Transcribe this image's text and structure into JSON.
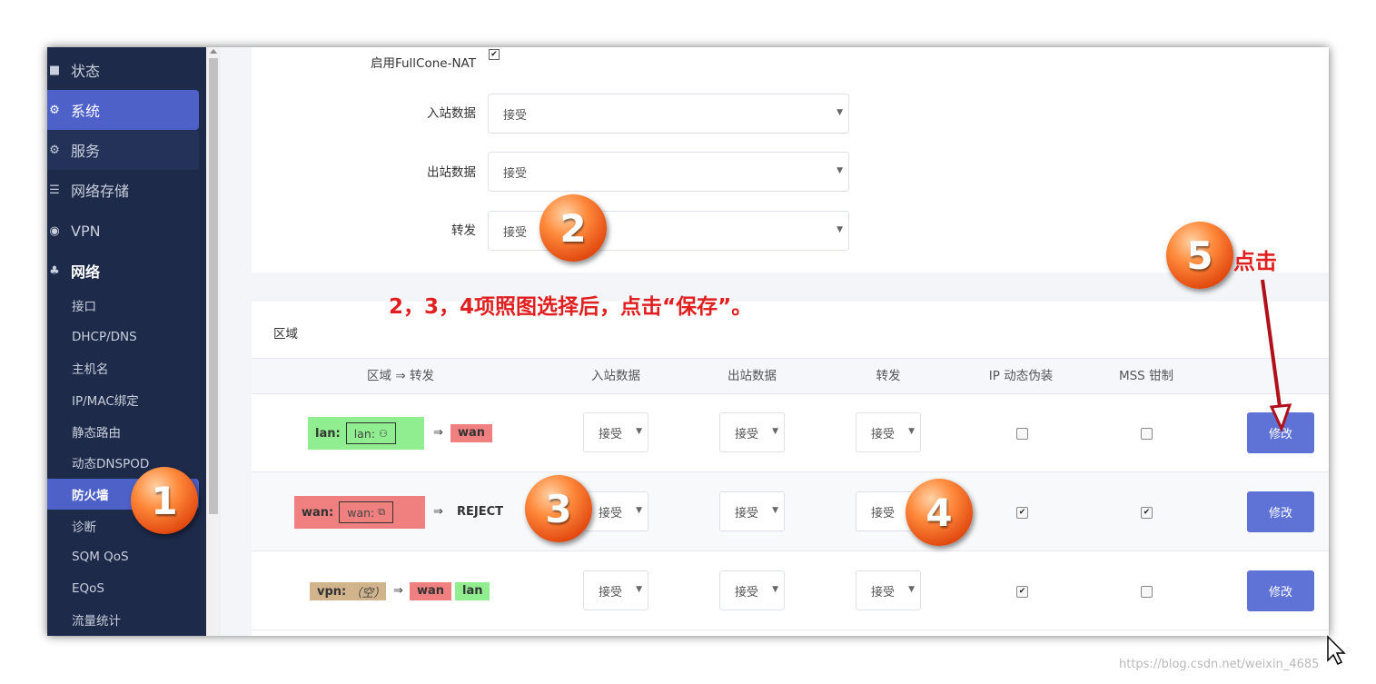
{
  "sidebar": {
    "items": [
      {
        "icon": "dashboard-icon",
        "glyph": "■",
        "label": "状态"
      },
      {
        "icon": "gear-icon",
        "glyph": "⚙",
        "label": "系统"
      },
      {
        "icon": "gears-icon",
        "glyph": "⚙",
        "label": "服务"
      },
      {
        "icon": "database-icon",
        "glyph": "☰",
        "label": "网络存储"
      },
      {
        "icon": "globe-icon",
        "glyph": "◉",
        "label": "VPN"
      },
      {
        "icon": "sitemap-icon",
        "glyph": "♣",
        "label": "网络"
      }
    ],
    "sub_items": [
      "接口",
      "DHCP/DNS",
      "主机名",
      "IP/MAC绑定",
      "静态路由",
      "动态DNSPOD",
      "防火墙",
      "诊断",
      "SQM QoS",
      "EQoS",
      "流量统计"
    ]
  },
  "general": {
    "fullcone_label": "启用FullCone-NAT",
    "fullcone_checked": "✔",
    "input_label": "入站数据",
    "input_value": "接受",
    "output_label": "出站数据",
    "output_value": "接受",
    "forward_label": "转发",
    "forward_value": "接受"
  },
  "zones": {
    "title": "区域",
    "headers": [
      "区域 ⇒ 转发",
      "入站数据",
      "出站数据",
      "转发",
      "IP 动态伪装",
      "MSS 钳制"
    ],
    "rows": [
      {
        "zone": "lan:",
        "iface": "lan:",
        "arrow": "⇒",
        "dest": [
          "wan"
        ],
        "input": "接受",
        "output": "接受",
        "forward": "接受",
        "masq": false,
        "mss": false,
        "button": "修改",
        "color": "#90ee90"
      },
      {
        "zone": "wan:",
        "iface": "wan:",
        "arrow": "⇒",
        "dest_text": "REJECT",
        "input": "接受",
        "output": "接受",
        "forward": "接受",
        "masq": true,
        "mss": true,
        "button": "修改",
        "color": "#f08080"
      },
      {
        "zone": "vpn:",
        "iface": "（空）",
        "arrow": "⇒",
        "dest": [
          "wan",
          "lan"
        ],
        "input": "接受",
        "output": "接受",
        "forward": "接受",
        "masq": true,
        "mss": false,
        "button": "修改",
        "color": "#d2b48c"
      }
    ],
    "check_glyph": "✔"
  },
  "annotations": {
    "n1": "1",
    "n2": "2",
    "n3": "3",
    "n4": "4",
    "n5": "5",
    "instruction": "2，3，4项照图选择后，点击“保存”。",
    "click": "点击"
  },
  "watermark": "https://blog.csdn.net/weixin_4685"
}
